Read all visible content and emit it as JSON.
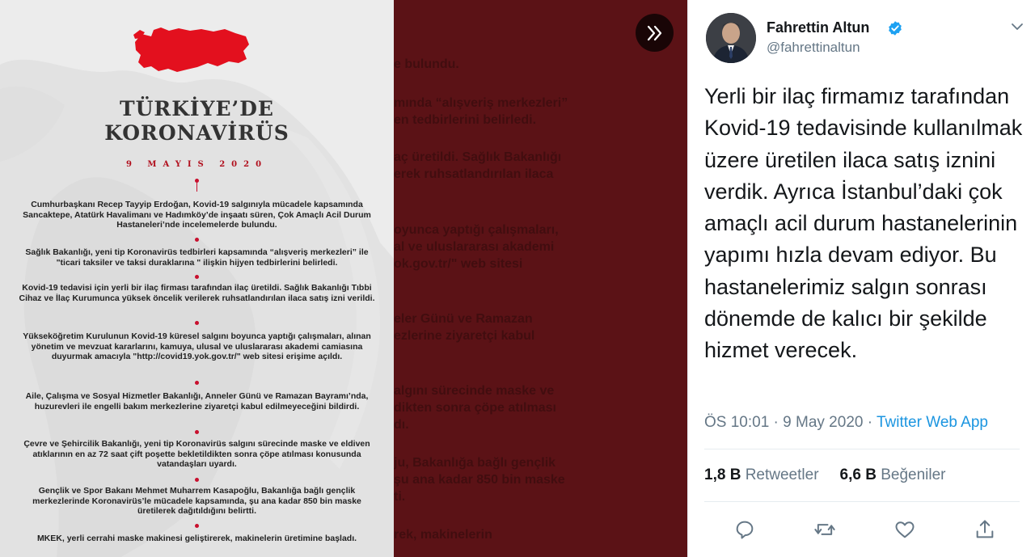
{
  "infographic": {
    "title_line1": "TÜRKİYE’DE",
    "title_line2": "KORONAVİRÜS",
    "date": "9 MAYIS 2020",
    "paragraphs": [
      "Cumhurbaşkanı Recep Tayyip Erdoğan, Kovid-19 salgınıyla mücadele kapsamında Sancaktepe, Atatürk Havalimanı ve Hadımköy’de inşaatı süren, Çok Amaçlı Acil Durum Hastaneleri’nde incelemelerde bulundu.",
      "Sağlık Bakanlığı, yeni tip Koronavirüs tedbirleri kapsamında “alışveriş merkezleri” ile \"ticari taksiler ve taksi duraklarına \" ilişkin hijyen tedbirlerini belirledi.",
      "Kovid-19 tedavisi için yerli bir ilaç firması tarafından ilaç üretildi. Sağlık Bakanlığı Tıbbi Cihaz ve İlaç Kurumunca yüksek öncelik verilerek ruhsatlandırılan ilaca satış izni verildi.",
      "Yükseköğretim Kurulunun Kovid-19 küresel salgını boyunca yaptığı çalışmaları, alınan yönetim ve mevzuat kararlarını, kamuya, ulusal ve uluslararası akademi camiasına duyurmak amacıyla \"http://covid19.yok.gov.tr/\" web sitesi erişime açıldı.",
      "Aile, Çalışma ve Sosyal Hizmetler Bakanlığı, Anneler Günü ve Ramazan Bayramı’nda, huzurevleri ile engelli bakım merkezlerine ziyaretçi kabul edilmeyeceğini bildirdi.",
      "Çevre ve Şehircilik Bakanlığı, yeni tip Koronavirüs salgını sürecinde maske ve eldiven atıklarının en az 72 saat çift poşette bekletildikten sonra çöpe atılması konusunda vatandaşları uyardı.",
      "Gençlik ve Spor Bakanı Mehmet Muharrem Kasapoğlu, Bakanlığa bağlı gençlik merkezlerinde Koronavirüs’le mücadele kapsamında, şu ana kadar 850 bin maske üretilerek dağıtıldığını belirtti.",
      "MKEK, yerli cerrahi maske makinesi geliştirerek, makinelerin üretimine başladı."
    ]
  },
  "background_text": {
    "lines": [
      "e bulundu.",
      "mında “alışveriş merkezleri”",
      "en tedbirlerini belirledi.",
      "aç üretildi. Sağlık Bakanlığı",
      "erek ruhsatlandırılan ilaca",
      "oyunca yaptığı çalışmaları,",
      "al ve uluslararası akademi",
      "ok.gov.tr/\" web sitesi",
      "eler Günü ve Ramazan",
      "ezlerine ziyaretçi kabul",
      "algını sürecinde maske ve",
      "dikten sonra çöpe atılması",
      "dı.",
      "ju, Bakanlığa bağlı gençlik",
      "şu ana kadar 850 bin maske",
      "ti.",
      "rek, makinelerin"
    ]
  },
  "viewer": {
    "next_icon": "double-chevron-right-icon"
  },
  "tweet": {
    "author_name": "Fahrettin Altun",
    "handle": "@fahrettinaltun",
    "text": "Yerli bir ilaç firmamız tarafından Kovid-19 tedavisinde kullanılmak üzere üretilen ilaca satış iznini verdik. Ayrıca İstanbul’daki çok amaçlı acil durum hastanelerinin yapımı hızla devam ediyor. Bu hastanelerimiz salgın sonrası dönemde de kalıcı bir şekilde hizmet verecek.",
    "time": "ÖS 10:01 · 9 May 2020 · ",
    "source": "Twitter Web App",
    "retweets_count": "1,8 B",
    "retweets_label": " Retweetler",
    "likes_count": "6,6 B",
    "likes_label": " Beğeniler",
    "actions": [
      "reply-icon",
      "retweet-icon",
      "like-icon",
      "share-icon"
    ]
  },
  "colors": {
    "accent": "#1b95e0",
    "turkey_red": "#e3101e",
    "overlay": "#5b1216"
  }
}
